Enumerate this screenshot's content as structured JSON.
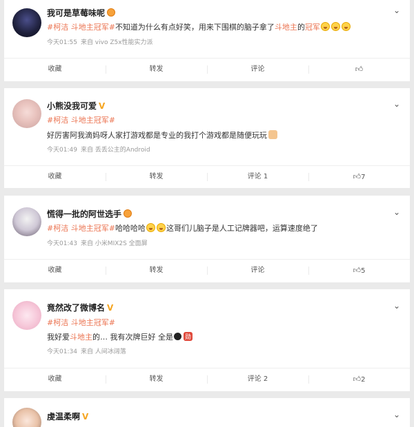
{
  "comments": [
    {
      "user": "我可是草莓味呢",
      "badge": "crown",
      "segments": [
        {
          "t": "#柯洁 斗地主冠军#",
          "link": true
        },
        {
          "t": "不知道为什么有点好笑，用来下围棋的脑子拿了",
          "link": false
        },
        {
          "t": "斗地主",
          "link": true
        },
        {
          "t": "的",
          "link": false
        },
        {
          "t": "冠军",
          "link": true
        }
      ],
      "emojis": 3,
      "time": "今天01:55",
      "source": "来自 vivo Z5x性能实力派",
      "actions": {
        "collect": "收藏",
        "repost": "转发",
        "comment": "评论",
        "like": ""
      }
    },
    {
      "user": "小熊没我可爱",
      "badge": "v",
      "line1": "#柯洁 斗地主冠军#",
      "line2": "好厉害阿我滴妈呀人家打游戏都是专业的我打个游戏都是随便玩玩",
      "time": "今天01:49",
      "source": "来自 丢丢公主的Android",
      "actions": {
        "collect": "收藏",
        "repost": "转发",
        "comment": "评论 1",
        "like": "7"
      }
    },
    {
      "user": "慌得一批的阿世选手",
      "badge": "crown",
      "hashtag": "#柯洁 斗地主冠军#",
      "text_a": "哈哈哈哈",
      "text_b": "这哥们儿脑子是人工记牌器吧，运算速度绝了",
      "time": "今天01:43",
      "source": "来自 小米MIX2S 全面屏",
      "actions": {
        "collect": "收藏",
        "repost": "转发",
        "comment": "评论",
        "like": "5"
      }
    },
    {
      "user": "竟然改了微博名",
      "badge": "v",
      "line1": "#柯洁 斗地主冠军#",
      "text_a": "我好爱",
      "link_a": "斗地主",
      "text_b": "的… 我有次牌巨好 全是",
      "sticker": "勋",
      "time": "今天01:34",
      "source": "来自 人间冰阔落",
      "actions": {
        "collect": "收藏",
        "repost": "转发",
        "comment": "评论 2",
        "like": "2"
      }
    },
    {
      "user": "虔温柔啊",
      "badge": "v"
    }
  ]
}
